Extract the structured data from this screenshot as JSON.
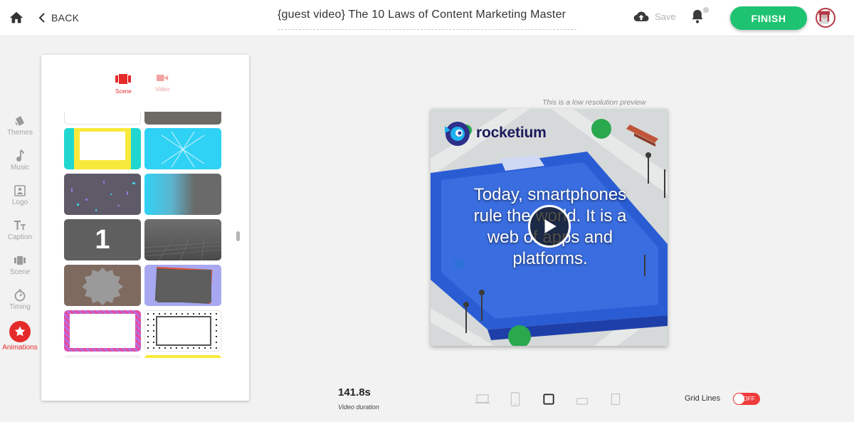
{
  "header": {
    "back_label": "BACK",
    "title": "{guest video} The 10 Laws of Content Marketing Master",
    "save_label": "Save",
    "finish_label": "FINISH"
  },
  "sidebar": {
    "items": [
      {
        "label": "Themes",
        "icon": "themes-icon"
      },
      {
        "label": "Music",
        "icon": "music-icon"
      },
      {
        "label": "Logo",
        "icon": "logo-icon"
      },
      {
        "label": "Caption",
        "icon": "caption-icon"
      },
      {
        "label": "Scene",
        "icon": "scene-icon"
      },
      {
        "label": "Timing",
        "icon": "timing-icon"
      },
      {
        "label": "Animations",
        "icon": "star-icon",
        "active": true
      }
    ]
  },
  "panel": {
    "tabs": [
      {
        "label": "Scene",
        "active": true
      },
      {
        "label": "Video",
        "active": false
      }
    ],
    "thumb_number": "1"
  },
  "preview": {
    "note": "This is a low resolution preview",
    "logo_text": "rocketium",
    "caption": "Today, smartphones rule the world. It is a web of apps and platforms."
  },
  "footer": {
    "duration": "141.8s",
    "duration_label": "Video duration",
    "gridlines_label": "Grid Lines",
    "gridlines_state": "OFF"
  },
  "colors": {
    "accent_red": "#e52a2a",
    "finish_green": "#1ec371"
  }
}
